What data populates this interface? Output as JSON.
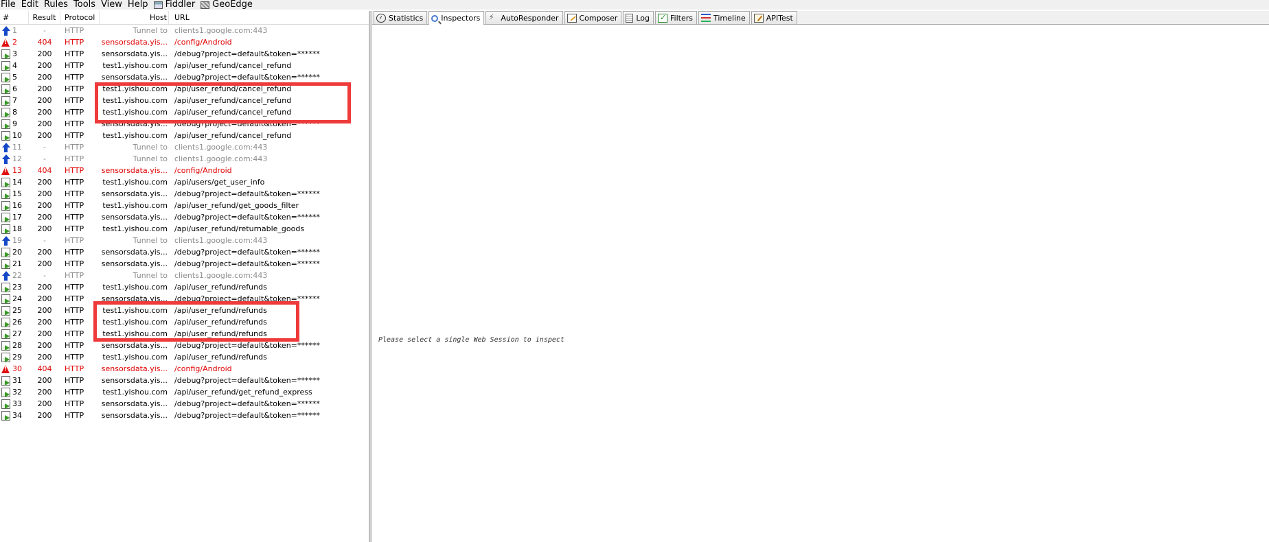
{
  "menubar": {
    "items": [
      "File",
      "Edit",
      "Rules",
      "Tools",
      "View",
      "Help"
    ],
    "extras": [
      {
        "label": "Fiddler",
        "icon": "fiddler-icon"
      },
      {
        "label": "GeoEdge",
        "icon": "geoedge-icon"
      }
    ]
  },
  "grid": {
    "columns": {
      "num": "#",
      "result": "Result",
      "protocol": "Protocol",
      "host": "Host",
      "url": "URL"
    },
    "rows": [
      {
        "num": "1",
        "result": "-",
        "protocol": "HTTP",
        "host": "Tunnel to",
        "url": "clients1.google.com:443",
        "kind": "tunnel"
      },
      {
        "num": "2",
        "result": "404",
        "protocol": "HTTP",
        "host": "sensorsdata.yis...",
        "url": "/config/Android",
        "kind": "error"
      },
      {
        "num": "3",
        "result": "200",
        "protocol": "HTTP",
        "host": "sensorsdata.yis...",
        "url": "/debug?project=default&token=******",
        "kind": "ok"
      },
      {
        "num": "4",
        "result": "200",
        "protocol": "HTTP",
        "host": "test1.yishou.com",
        "url": "/api/user_refund/cancel_refund",
        "kind": "ok"
      },
      {
        "num": "5",
        "result": "200",
        "protocol": "HTTP",
        "host": "sensorsdata.yis...",
        "url": "/debug?project=default&token=******",
        "kind": "ok"
      },
      {
        "num": "6",
        "result": "200",
        "protocol": "HTTP",
        "host": "test1.yishou.com",
        "url": "/api/user_refund/cancel_refund",
        "kind": "ok"
      },
      {
        "num": "7",
        "result": "200",
        "protocol": "HTTP",
        "host": "test1.yishou.com",
        "url": "/api/user_refund/cancel_refund",
        "kind": "ok"
      },
      {
        "num": "8",
        "result": "200",
        "protocol": "HTTP",
        "host": "test1.yishou.com",
        "url": "/api/user_refund/cancel_refund",
        "kind": "ok"
      },
      {
        "num": "9",
        "result": "200",
        "protocol": "HTTP",
        "host": "sensorsdata.yis...",
        "url": "/debug?project=default&token=******",
        "kind": "ok"
      },
      {
        "num": "10",
        "result": "200",
        "protocol": "HTTP",
        "host": "test1.yishou.com",
        "url": "/api/user_refund/cancel_refund",
        "kind": "ok"
      },
      {
        "num": "11",
        "result": "-",
        "protocol": "HTTP",
        "host": "Tunnel to",
        "url": "clients1.google.com:443",
        "kind": "tunnel"
      },
      {
        "num": "12",
        "result": "-",
        "protocol": "HTTP",
        "host": "Tunnel to",
        "url": "clients1.google.com:443",
        "kind": "tunnel"
      },
      {
        "num": "13",
        "result": "404",
        "protocol": "HTTP",
        "host": "sensorsdata.yis...",
        "url": "/config/Android",
        "kind": "error"
      },
      {
        "num": "14",
        "result": "200",
        "protocol": "HTTP",
        "host": "test1.yishou.com",
        "url": "/api/users/get_user_info",
        "kind": "ok"
      },
      {
        "num": "15",
        "result": "200",
        "protocol": "HTTP",
        "host": "sensorsdata.yis...",
        "url": "/debug?project=default&token=******",
        "kind": "ok"
      },
      {
        "num": "16",
        "result": "200",
        "protocol": "HTTP",
        "host": "test1.yishou.com",
        "url": "/api/user_refund/get_goods_filter",
        "kind": "ok"
      },
      {
        "num": "17",
        "result": "200",
        "protocol": "HTTP",
        "host": "sensorsdata.yis...",
        "url": "/debug?project=default&token=******",
        "kind": "ok"
      },
      {
        "num": "18",
        "result": "200",
        "protocol": "HTTP",
        "host": "test1.yishou.com",
        "url": "/api/user_refund/returnable_goods",
        "kind": "ok"
      },
      {
        "num": "19",
        "result": "-",
        "protocol": "HTTP",
        "host": "Tunnel to",
        "url": "clients1.google.com:443",
        "kind": "tunnel"
      },
      {
        "num": "20",
        "result": "200",
        "protocol": "HTTP",
        "host": "sensorsdata.yis...",
        "url": "/debug?project=default&token=******",
        "kind": "ok"
      },
      {
        "num": "21",
        "result": "200",
        "protocol": "HTTP",
        "host": "sensorsdata.yis...",
        "url": "/debug?project=default&token=******",
        "kind": "ok"
      },
      {
        "num": "22",
        "result": "-",
        "protocol": "HTTP",
        "host": "Tunnel to",
        "url": "clients1.google.com:443",
        "kind": "tunnel"
      },
      {
        "num": "23",
        "result": "200",
        "protocol": "HTTP",
        "host": "test1.yishou.com",
        "url": "/api/user_refund/refunds",
        "kind": "ok"
      },
      {
        "num": "24",
        "result": "200",
        "protocol": "HTTP",
        "host": "sensorsdata.yis...",
        "url": "/debug?project=default&token=******",
        "kind": "ok"
      },
      {
        "num": "25",
        "result": "200",
        "protocol": "HTTP",
        "host": "test1.yishou.com",
        "url": "/api/user_refund/refunds",
        "kind": "ok"
      },
      {
        "num": "26",
        "result": "200",
        "protocol": "HTTP",
        "host": "test1.yishou.com",
        "url": "/api/user_refund/refunds",
        "kind": "ok"
      },
      {
        "num": "27",
        "result": "200",
        "protocol": "HTTP",
        "host": "test1.yishou.com",
        "url": "/api/user_refund/refunds",
        "kind": "ok"
      },
      {
        "num": "28",
        "result": "200",
        "protocol": "HTTP",
        "host": "sensorsdata.yis...",
        "url": "/debug?project=default&token=******",
        "kind": "ok"
      },
      {
        "num": "29",
        "result": "200",
        "protocol": "HTTP",
        "host": "test1.yishou.com",
        "url": "/api/user_refund/refunds",
        "kind": "ok"
      },
      {
        "num": "30",
        "result": "404",
        "protocol": "HTTP",
        "host": "sensorsdata.yis...",
        "url": "/config/Android",
        "kind": "error"
      },
      {
        "num": "31",
        "result": "200",
        "protocol": "HTTP",
        "host": "sensorsdata.yis...",
        "url": "/debug?project=default&token=******",
        "kind": "ok"
      },
      {
        "num": "32",
        "result": "200",
        "protocol": "HTTP",
        "host": "test1.yishou.com",
        "url": "/api/user_refund/get_refund_express",
        "kind": "ok"
      },
      {
        "num": "33",
        "result": "200",
        "protocol": "HTTP",
        "host": "sensorsdata.yis...",
        "url": "/debug?project=default&token=******",
        "kind": "ok"
      },
      {
        "num": "34",
        "result": "200",
        "protocol": "HTTP",
        "host": "sensorsdata.yis...",
        "url": "/debug?project=default&token=******",
        "kind": "ok"
      }
    ]
  },
  "tabs": [
    {
      "label": "Statistics",
      "icon": "statistics-icon"
    },
    {
      "label": "Inspectors",
      "icon": "inspectors-icon",
      "active": true
    },
    {
      "label": "AutoResponder",
      "icon": "autoresponder-icon"
    },
    {
      "label": "Composer",
      "icon": "composer-icon"
    },
    {
      "label": "Log",
      "icon": "log-icon"
    },
    {
      "label": "Filters",
      "icon": "filters-icon"
    },
    {
      "label": "Timeline",
      "icon": "timeline-icon"
    },
    {
      "label": "APITest",
      "icon": "apitest-icon"
    }
  ],
  "inspector": {
    "empty_message": "Please select a single Web Session to inspect"
  },
  "colors": {
    "error_text": "#e00000",
    "tunnel_text": "#8c8c8c",
    "highlight_box": "#ee3a3a"
  }
}
